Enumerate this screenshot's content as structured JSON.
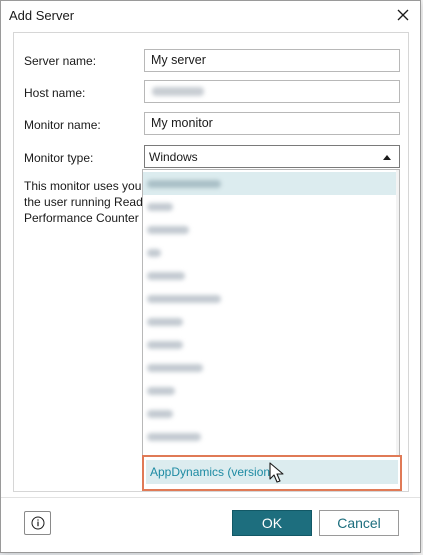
{
  "window": {
    "title": "Add Server"
  },
  "form": {
    "server_name_label": "Server name:",
    "server_name_value": "My server",
    "host_name_label": "Host name:",
    "monitor_name_label": "Monitor name:",
    "monitor_name_value": "My monitor",
    "monitor_type_label": "Monitor type:",
    "monitor_type_value": "Windows",
    "description_lines": [
      "This monitor uses your",
      "the user running Ready",
      "Performance Counter"
    ]
  },
  "dropdown": {
    "highlighted_option": "AppDynamics (version"
  },
  "buttons": {
    "ok": "OK",
    "cancel": "Cancel"
  },
  "icons": {
    "close": "close-icon",
    "info": "info-icon",
    "caret": "caret-up-icon",
    "cursor": "mouse-pointer-icon"
  },
  "colors": {
    "accent": "#1d6e7e",
    "highlight_border": "#e07a56",
    "selection_bg": "#dcecef",
    "link_text": "#1e8ba3"
  }
}
